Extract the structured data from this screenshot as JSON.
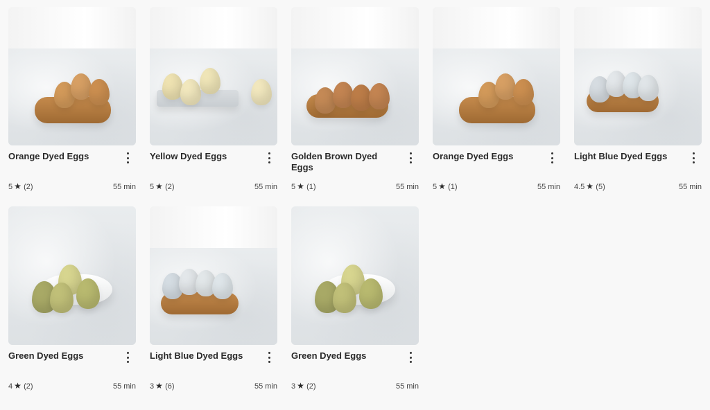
{
  "cards": [
    {
      "title": "Orange Dyed Eggs",
      "rating": "5",
      "reviews": "(2)",
      "time": "55 min",
      "colors": {
        "egg": "#d39a5a",
        "accent": "#c48a4c"
      },
      "scene": "tray"
    },
    {
      "title": "Yellow Dyed Eggs",
      "rating": "5",
      "reviews": "(2)",
      "time": "55 min",
      "colors": {
        "egg": "#f0e6b8",
        "accent": "#d9c067"
      },
      "scene": "rack"
    },
    {
      "title": "Golden Brown Dyed Eggs",
      "rating": "5",
      "reviews": "(1)",
      "time": "55 min",
      "colors": {
        "egg": "#c48552",
        "accent": "#b97b44"
      },
      "scene": "tray"
    },
    {
      "title": "Orange Dyed Eggs",
      "rating": "5",
      "reviews": "(1)",
      "time": "55 min",
      "colors": {
        "egg": "#d39a5a",
        "accent": "#c48a4c"
      },
      "scene": "tray"
    },
    {
      "title": "Light Blue Dyed Eggs",
      "rating": "4.5",
      "reviews": "(5)",
      "time": "55 min",
      "colors": {
        "egg": "#dfe6ea",
        "accent": "#a7b7c3"
      },
      "scene": "tray"
    },
    {
      "title": "Green Dyed Eggs",
      "rating": "4",
      "reviews": "(2)",
      "time": "55 min",
      "colors": {
        "egg": "#b8b96f",
        "accent": "#a2a35b"
      },
      "scene": "bowl"
    },
    {
      "title": "Light Blue Dyed Eggs",
      "rating": "3",
      "reviews": "(6)",
      "time": "55 min",
      "colors": {
        "egg": "#e3e8ea",
        "accent": "#a7b7c3"
      },
      "scene": "tray"
    },
    {
      "title": "Green Dyed Eggs",
      "rating": "3",
      "reviews": "(2)",
      "time": "55 min",
      "colors": {
        "egg": "#b8b96f",
        "accent": "#a2a35b"
      },
      "scene": "bowl"
    }
  ],
  "icons": {
    "star": "star-icon",
    "kebab": "more-vertical-icon"
  }
}
